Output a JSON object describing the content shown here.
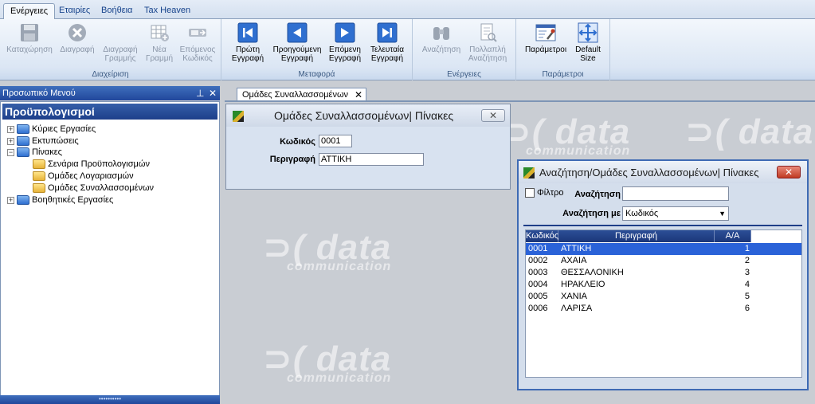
{
  "ribbon": {
    "tabs": [
      "Ενέργειες",
      "Εταιρίες",
      "Βοήθεια",
      "Tax Heaven"
    ],
    "groups": {
      "management": {
        "label": "Διαχείριση",
        "save": "Καταχώρηση",
        "delete": "Διαγραφή",
        "delete_row": [
          "Διαγραφή",
          "Γραμμής"
        ],
        "new_row": [
          "Νέα",
          "Γραμμή"
        ],
        "next_code": [
          "Επόμενος",
          "Κωδικός"
        ]
      },
      "navigation": {
        "label": "Μεταφορά",
        "first": [
          "Πρώτη",
          "Εγγραφή"
        ],
        "previous": [
          "Προηγούμενη",
          "Εγγραφή"
        ],
        "next": [
          "Επόμενη",
          "Εγγραφή"
        ],
        "last": [
          "Τελευταία",
          "Εγγραφή"
        ]
      },
      "actions": {
        "label": "Ενέργειες",
        "search": "Αναζήτηση",
        "multi_search": [
          "Πολλαπλή",
          "Αναζήτηση"
        ]
      },
      "parameters": {
        "label": "Παράμετροι",
        "params": "Παράμετροι",
        "default_size": [
          "Default",
          "Size"
        ]
      }
    }
  },
  "left_panel": {
    "header": "Προσωπικό Μενού",
    "title": "Προϋπολογισμοί",
    "tree": [
      {
        "label": "Κύριες Εργασίες",
        "expander": "+",
        "level": 0,
        "color": "blue"
      },
      {
        "label": "Εκτυπώσεις",
        "expander": "+",
        "level": 0,
        "color": "blue"
      },
      {
        "label": "Πίνακες",
        "expander": "−",
        "level": 0,
        "color": "blue"
      },
      {
        "label": "Σενάρια Προϋπολογισμών",
        "level": 1,
        "color": "yellow"
      },
      {
        "label": "Ομάδες Λογαριασμών",
        "level": 1,
        "color": "yellow"
      },
      {
        "label": "Ομάδες Συναλλασσομένων",
        "level": 1,
        "color": "yellow"
      },
      {
        "label": "Βοηθητικές Εργασίες",
        "expander": "+",
        "level": 0,
        "color": "blue"
      }
    ]
  },
  "document": {
    "tab_label": "Ομάδες Συναλλασσομένων",
    "watermark_main": "data",
    "watermark_sub": "communication"
  },
  "form": {
    "title": "Ομάδες Συναλλασσομένων| Πίνακες",
    "code_label": "Κωδικός",
    "code_value": "0001",
    "description_label": "Περιγραφή",
    "description_value": "ΑΤΤΙΚΗ"
  },
  "search_window": {
    "title": "Αναζήτηση/Ομάδες Συναλλασσομένων| Πίνακες",
    "filter_label": "Φίλτρο",
    "search_label": "Αναζήτηση",
    "search_value": "",
    "search_by_label": "Αναζήτηση με",
    "search_by_value": "Κωδικός",
    "columns": [
      "Κωδικός",
      "Περιγραφή",
      "Α/Α"
    ],
    "rows": [
      {
        "code": "0001",
        "description": "ΑΤΤΙΚΗ",
        "aa": "1"
      },
      {
        "code": "0002",
        "description": "ΑΧΑΙΑ",
        "aa": "2"
      },
      {
        "code": "0003",
        "description": "ΘΕΣΣΑΛΟΝΙΚΗ",
        "aa": "3"
      },
      {
        "code": "0004",
        "description": "ΗΡΑΚΛΕΙΟ",
        "aa": "4"
      },
      {
        "code": "0005",
        "description": "ΧΑΝΙΑ",
        "aa": "5"
      },
      {
        "code": "0006",
        "description": "ΛΑΡΙΣΑ",
        "aa": "6"
      }
    ],
    "selected_row": 0
  },
  "colors": {
    "accent": "#21479b",
    "selection": "#2a62d8",
    "close_red": "#c03a22"
  }
}
